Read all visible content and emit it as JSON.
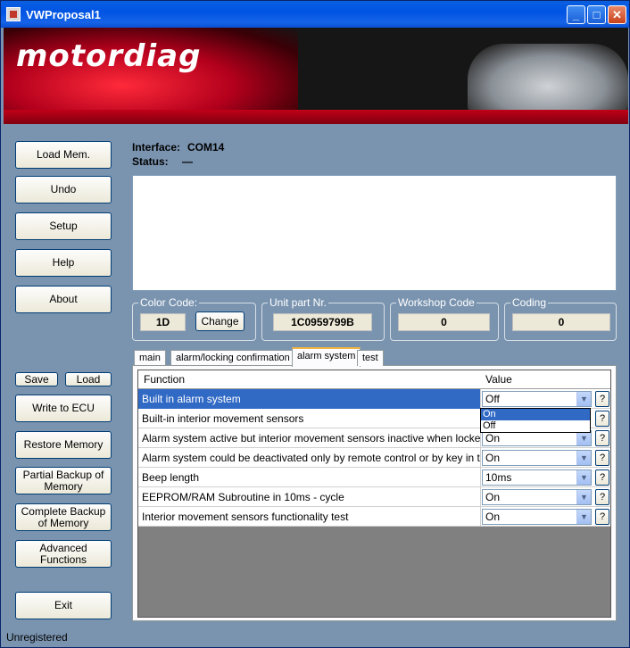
{
  "window": {
    "title": "VWProposal1",
    "min_label": "_",
    "max_label": "□",
    "close_label": "✕"
  },
  "banner": {
    "logo": "motordiag"
  },
  "sidebar": {
    "load_mem": "Load Mem.",
    "undo": "Undo",
    "setup": "Setup",
    "help": "Help",
    "about": "About",
    "save": "Save",
    "load": "Load",
    "write_ecu": "Write to ECU",
    "restore_memory": "Restore Memory",
    "partial_backup": "Partial Backup of Memory",
    "complete_backup": "Complete Backup of Memory",
    "advanced": "Advanced Functions",
    "exit": "Exit"
  },
  "header": {
    "interface_label": "Interface:",
    "interface_value": "COM14",
    "status_label": "Status:",
    "status_value": "—"
  },
  "fields": {
    "color_code_label": "Color Code:",
    "color_code_value": "1D",
    "change_button": "Change",
    "unit_part_label": "Unit part Nr.",
    "unit_part_value": "1C0959799B",
    "workshop_label": "Workshop Code",
    "workshop_value": "0",
    "coding_label": "Coding",
    "coding_value": "0"
  },
  "tabs": [
    {
      "label": "main"
    },
    {
      "label": "alarm/locking confirmation"
    },
    {
      "label": "alarm system",
      "active": true
    },
    {
      "label": "test"
    }
  ],
  "grid": {
    "columns": [
      "Function",
      "Value"
    ],
    "rows": [
      {
        "function": "Built in alarm system",
        "value": "Off",
        "selected": true
      },
      {
        "function": "Built-in interior movement sensors",
        "value": ""
      },
      {
        "function": "Alarm system active but interior movement sensors inactive when locked with...",
        "value": "On"
      },
      {
        "function": "Alarm system could be deactivated only by remote control or by key in the igni...",
        "value": "On"
      },
      {
        "function": "Beep length",
        "value": "10ms"
      },
      {
        "function": "EEPROM/RAM Subroutine in 10ms - cycle",
        "value": "On"
      },
      {
        "function": "Interior movement sensors functionality test",
        "value": "On"
      }
    ],
    "help_label": "?",
    "dropdown_options": [
      "On",
      "Off"
    ]
  },
  "statusbar": {
    "text": "Unregistered"
  }
}
